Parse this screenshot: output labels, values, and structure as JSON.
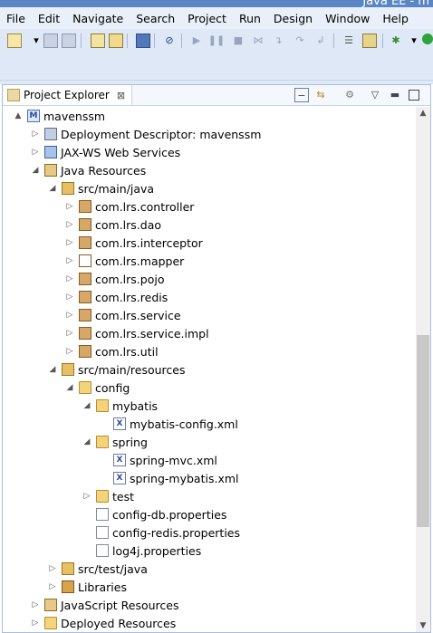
{
  "window": {
    "title_fragment": "Java EE - m"
  },
  "menu": [
    "File",
    "Edit",
    "Navigate",
    "Search",
    "Project",
    "Run",
    "Design",
    "Window",
    "Help"
  ],
  "explorer": {
    "title": "Project Explorer",
    "close_glyph": "⊠"
  },
  "tree": [
    {
      "label": "mavenssm",
      "depth": 0,
      "toggle": "▲",
      "icon": "project-icon",
      "cls": "proj",
      "glyph": "M"
    },
    {
      "label": "Deployment Descriptor: mavenssm",
      "depth": 1,
      "toggle": "▷",
      "icon": "deployment-descriptor-icon",
      "cls": "dd",
      "glyph": ""
    },
    {
      "label": "JAX-WS Web Services",
      "depth": 1,
      "toggle": "▷",
      "icon": "web-services-icon",
      "cls": "ws",
      "glyph": ""
    },
    {
      "label": "Java Resources",
      "depth": 1,
      "toggle": "◢",
      "icon": "java-resources-icon",
      "cls": "jr",
      "glyph": ""
    },
    {
      "label": "src/main/java",
      "depth": 2,
      "toggle": "◢",
      "icon": "source-folder-icon",
      "cls": "srcfolder",
      "glyph": ""
    },
    {
      "label": "com.lrs.controller",
      "depth": 3,
      "toggle": "▷",
      "icon": "package-icon",
      "cls": "pkg",
      "glyph": ""
    },
    {
      "label": "com.lrs.dao",
      "depth": 3,
      "toggle": "▷",
      "icon": "package-icon",
      "cls": "pkg",
      "glyph": ""
    },
    {
      "label": "com.lrs.interceptor",
      "depth": 3,
      "toggle": "▷",
      "icon": "package-icon",
      "cls": "pkg",
      "glyph": ""
    },
    {
      "label": "com.lrs.mapper",
      "depth": 3,
      "toggle": "▷",
      "icon": "empty-package-icon",
      "cls": "pkg-empty",
      "glyph": ""
    },
    {
      "label": "com.lrs.pojo",
      "depth": 3,
      "toggle": "▷",
      "icon": "package-icon",
      "cls": "pkg",
      "glyph": ""
    },
    {
      "label": "com.lrs.redis",
      "depth": 3,
      "toggle": "▷",
      "icon": "package-icon",
      "cls": "pkg",
      "glyph": ""
    },
    {
      "label": "com.lrs.service",
      "depth": 3,
      "toggle": "▷",
      "icon": "package-icon",
      "cls": "pkg",
      "glyph": ""
    },
    {
      "label": "com.lrs.service.impl",
      "depth": 3,
      "toggle": "▷",
      "icon": "package-icon",
      "cls": "pkg",
      "glyph": ""
    },
    {
      "label": "com.lrs.util",
      "depth": 3,
      "toggle": "▷",
      "icon": "package-icon",
      "cls": "pkg",
      "glyph": ""
    },
    {
      "label": "src/main/resources",
      "depth": 2,
      "toggle": "◢",
      "icon": "source-folder-icon",
      "cls": "srcfolder",
      "glyph": ""
    },
    {
      "label": "config",
      "depth": 3,
      "toggle": "◢",
      "icon": "folder-open-icon",
      "cls": "folder",
      "glyph": ""
    },
    {
      "label": "mybatis",
      "depth": 4,
      "toggle": "◢",
      "icon": "folder-open-icon",
      "cls": "folder",
      "glyph": ""
    },
    {
      "label": "mybatis-config.xml",
      "depth": 5,
      "toggle": "",
      "icon": "xml-file-icon",
      "cls": "xmlf",
      "glyph": "X"
    },
    {
      "label": "spring",
      "depth": 4,
      "toggle": "◢",
      "icon": "folder-open-icon",
      "cls": "folder",
      "glyph": ""
    },
    {
      "label": "spring-mvc.xml",
      "depth": 5,
      "toggle": "",
      "icon": "xml-file-icon",
      "cls": "xmlf",
      "glyph": "X"
    },
    {
      "label": "spring-mybatis.xml",
      "depth": 5,
      "toggle": "",
      "icon": "xml-file-icon",
      "cls": "xmlf",
      "glyph": "X"
    },
    {
      "label": "test",
      "depth": 4,
      "toggle": "▷",
      "icon": "folder-icon",
      "cls": "folder",
      "glyph": ""
    },
    {
      "label": "config-db.properties",
      "depth": 4,
      "toggle": "",
      "icon": "properties-file-icon",
      "cls": "propf",
      "glyph": ""
    },
    {
      "label": "config-redis.properties",
      "depth": 4,
      "toggle": "",
      "icon": "properties-file-icon",
      "cls": "propf",
      "glyph": ""
    },
    {
      "label": "log4j.properties",
      "depth": 4,
      "toggle": "",
      "icon": "properties-file-icon",
      "cls": "propf",
      "glyph": ""
    },
    {
      "label": "src/test/java",
      "depth": 2,
      "toggle": "▷",
      "icon": "source-folder-icon",
      "cls": "srcfolder",
      "glyph": ""
    },
    {
      "label": "Libraries",
      "depth": 2,
      "toggle": "▷",
      "icon": "libraries-icon",
      "cls": "lib",
      "glyph": ""
    },
    {
      "label": "JavaScript Resources",
      "depth": 1,
      "toggle": "▷",
      "icon": "javascript-resources-icon",
      "cls": "jsr",
      "glyph": ""
    },
    {
      "label": "Deployed Resources",
      "depth": 1,
      "toggle": "▷",
      "icon": "deployed-resources-icon",
      "cls": "folder",
      "glyph": ""
    }
  ]
}
